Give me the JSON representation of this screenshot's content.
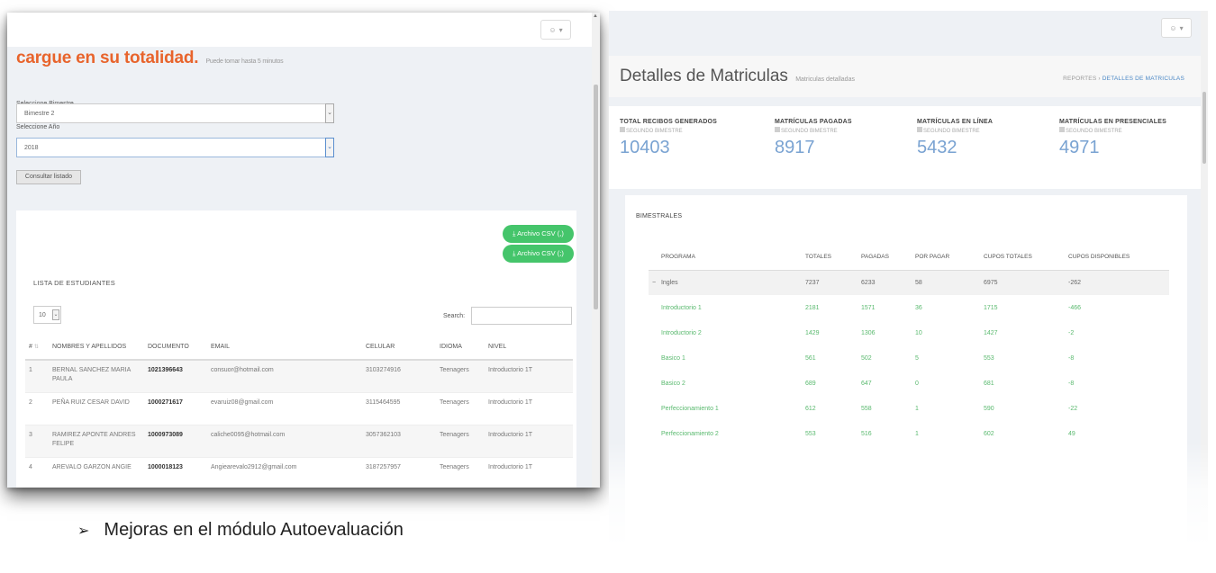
{
  "left": {
    "user_button_icon": "user-menu-icon",
    "heading": "cargue en su totalidad.",
    "heading_hint": "Puede tomar hasta 5 minutos",
    "bimestre_label": "Seleccione Bimestre",
    "bimestre_value": "Bimestre 2",
    "year_label": "Seleccione Año",
    "year_value": "2018",
    "consultar_button": "Consultar listado",
    "csv_button_1": "Archivo CSV (,)",
    "csv_button_2": "Archivo CSV (;)",
    "list_title": "LISTA DE ESTUDIANTES",
    "page_length": "10",
    "search_label": "Search:",
    "columns": [
      "#",
      "NOMBRES Y APELLIDOS",
      "DOCUMENTO",
      "EMAIL",
      "CELULAR",
      "IDIOMA",
      "NIVEL"
    ],
    "rows": [
      [
        "1",
        "BERNAL SANCHEZ MARIA PAULA",
        "1021396643",
        "consuor@hotmail.com",
        "3103274916",
        "Teenagers",
        "Introductorio 1T"
      ],
      [
        "2",
        "PEÑA RUIZ CESAR DAVID",
        "1000271617",
        "evaruiz08@gmail.com",
        "3115464595",
        "Teenagers",
        "Introductorio 1T"
      ],
      [
        "3",
        "RAMIREZ APONTE ANDRES FELIPE",
        "1000973089",
        "caliche0095@hotmail.com",
        "3057362103",
        "Teenagers",
        "Introductorio 1T"
      ],
      [
        "4",
        "AREVALO GARZON ANGIE",
        "1000018123",
        "Angiearevalo2912@gmail.com",
        "3187257957",
        "Teenagers",
        "Introductorio 1T"
      ]
    ]
  },
  "right": {
    "page_title": "Detalles de Matriculas",
    "page_subtitle": "Matriculas detalladas",
    "breadcrumb_home": "REPORTES",
    "breadcrumb_sep": "›",
    "breadcrumb_active": "DETALLES DE MATRICULAS",
    "stats": [
      {
        "label": "TOTAL RECIBOS GENERADOS",
        "sub": "SEGUNDO BIMESTRE",
        "value": "10403"
      },
      {
        "label": "MATRÍCULAS PAGADAS",
        "sub": "SEGUNDO BIMESTRE",
        "value": "8917"
      },
      {
        "label": "MATRÍCULAS EN LÍNEA",
        "sub": "SEGUNDO BIMESTRE",
        "value": "5432"
      },
      {
        "label": "MATRÍCULAS EN PRESENCIALES",
        "sub": "SEGUNDO BIMESTRE",
        "value": "4971"
      }
    ],
    "bimestrales_title": "BIMESTRALES",
    "columns": [
      "PROGRAMA",
      "TOTALES",
      "PAGADAS",
      "POR PAGAR",
      "CUPOS TOTALES",
      "CUPOS DISPONIBLES"
    ],
    "group_row": {
      "toggle": "−",
      "name": "Ingles",
      "values": [
        "7237",
        "6233",
        "58",
        "6975",
        "-262"
      ]
    },
    "rows": [
      [
        "Introductorio 1",
        "2181",
        "1571",
        "36",
        "1715",
        "-466"
      ],
      [
        "Introductorio 2",
        "1429",
        "1306",
        "10",
        "1427",
        "-2"
      ],
      [
        "Basico 1",
        "561",
        "502",
        "5",
        "553",
        "-8"
      ],
      [
        "Basico 2",
        "689",
        "647",
        "0",
        "681",
        "-8"
      ],
      [
        "Perfeccionamiento 1",
        "612",
        "558",
        "1",
        "590",
        "-22"
      ],
      [
        "Perfeccionamiento 2",
        "553",
        "516",
        "1",
        "602",
        "49"
      ],
      [
        "",
        "",
        "",
        "",
        "",
        ""
      ]
    ]
  },
  "bullet": "Mejoras en el módulo Autoevaluación"
}
